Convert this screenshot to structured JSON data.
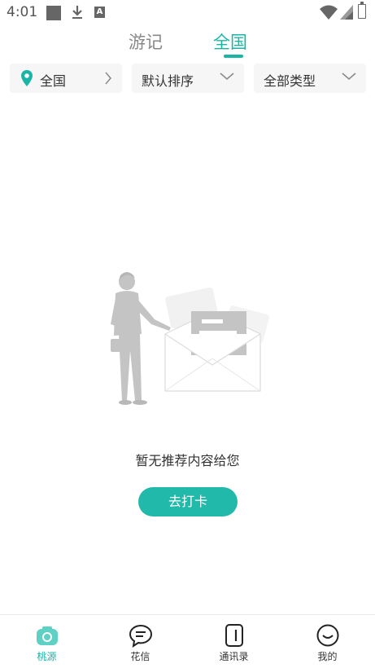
{
  "status_bar": {
    "time": "4:01",
    "icons": [
      "notification-square-icon",
      "download-icon",
      "a-icon",
      "wifi-icon",
      "signal-icon",
      "battery-icon"
    ],
    "a_glyph": "A"
  },
  "tabs": [
    {
      "label": "游记",
      "active": false
    },
    {
      "label": "全国",
      "active": true
    }
  ],
  "filters": {
    "region": "全国",
    "sort": "默认排序",
    "type": "全部类型"
  },
  "empty_state": {
    "message": "暂无推荐内容给您",
    "button_label": "去打卡"
  },
  "bottom_nav": [
    {
      "label": "桃源",
      "icon": "camera-icon",
      "active": true
    },
    {
      "label": "花信",
      "icon": "chat-bubble-icon",
      "active": false
    },
    {
      "label": "通讯录",
      "icon": "contacts-icon",
      "active": false
    },
    {
      "label": "我的",
      "icon": "smile-icon",
      "active": false
    }
  ],
  "colors": {
    "accent": "#1bb5a6",
    "button": "#21b9aa",
    "filter_bg": "#f6f6f6"
  }
}
